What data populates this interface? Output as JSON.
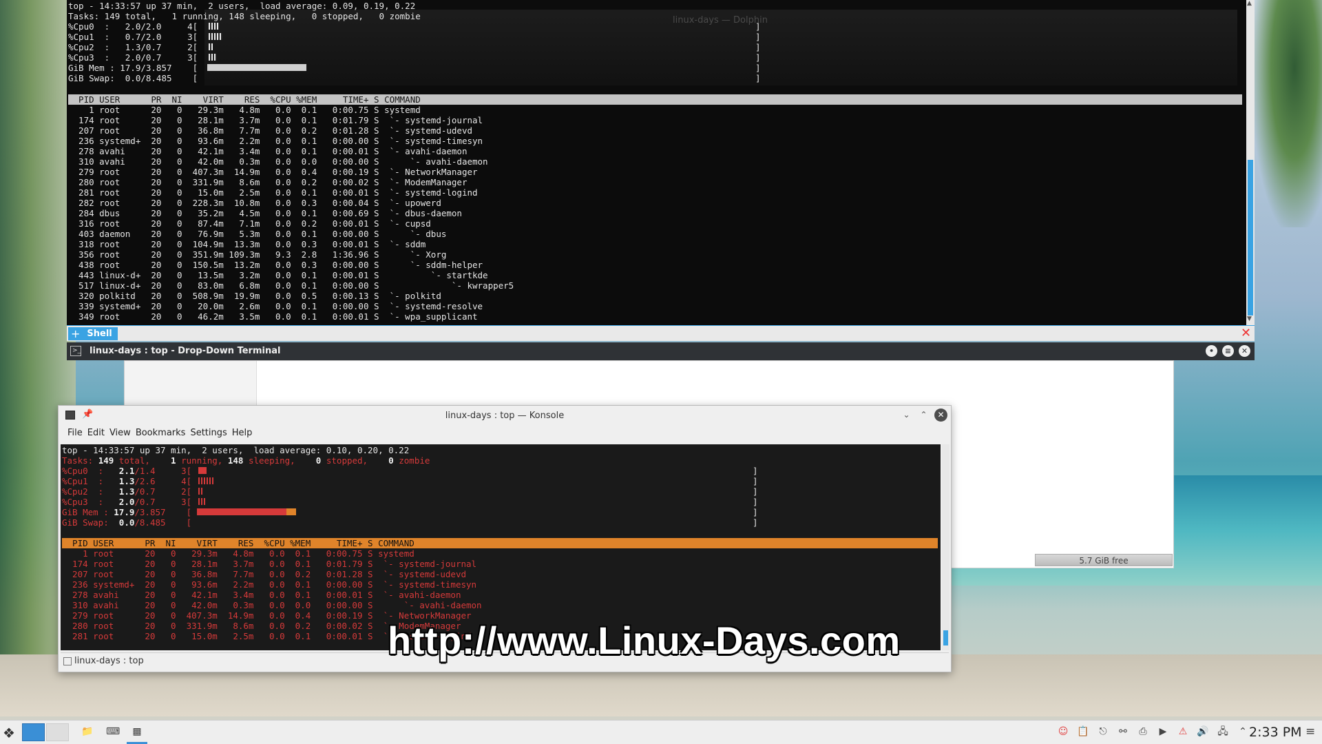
{
  "dropdown_terminal": {
    "ghost_title": "linux-days — Dolphin",
    "top_lines": [
      "top - 14:33:57 up 37 min,  2 users,  load average: 0.09, 0.19, 0.22",
      "Tasks: 149 total,   1 running, 148 sleeping,   0 stopped,   0 zombie",
      "%Cpu0  :   2.0/2.0     4[",
      "%Cpu1  :   0.7/2.0     3[",
      "%Cpu2  :   1.3/0.7     2[",
      "%Cpu3  :   2.0/0.7     3[",
      "GiB Mem : 17.9/3.857    [",
      "GiB Swap:  0.0/8.485    ["
    ],
    "header": "  PID USER      PR  NI    VIRT    RES  %CPU %MEM     TIME+ S COMMAND",
    "rows": [
      "    1 root      20   0   29.3m   4.8m   0.0  0.1   0:00.75 S systemd",
      "  174 root      20   0   28.1m   3.7m   0.0  0.1   0:01.79 S  `- systemd-journal",
      "  207 root      20   0   36.8m   7.7m   0.0  0.2   0:01.28 S  `- systemd-udevd",
      "  236 systemd+  20   0   93.6m   2.2m   0.0  0.1   0:00.00 S  `- systemd-timesyn",
      "  278 avahi     20   0   42.1m   3.4m   0.0  0.1   0:00.01 S  `- avahi-daemon",
      "  310 avahi     20   0   42.0m   0.3m   0.0  0.0   0:00.00 S      `- avahi-daemon",
      "  279 root      20   0  407.3m  14.9m   0.0  0.4   0:00.19 S  `- NetworkManager",
      "  280 root      20   0  331.9m   8.6m   0.0  0.2   0:00.02 S  `- ModemManager",
      "  281 root      20   0   15.0m   2.5m   0.0  0.1   0:00.01 S  `- systemd-logind",
      "  282 root      20   0  228.3m  10.8m   0.0  0.3   0:00.04 S  `- upowerd",
      "  284 dbus      20   0   35.2m   4.5m   0.0  0.1   0:00.69 S  `- dbus-daemon",
      "  316 root      20   0   87.4m   7.1m   0.0  0.2   0:00.01 S  `- cupsd",
      "  403 daemon    20   0   76.9m   5.3m   0.0  0.1   0:00.00 S      `- dbus",
      "  318 root      20   0  104.9m  13.3m   0.0  0.3   0:00.01 S  `- sddm",
      "  356 root      20   0  351.9m 109.3m   9.3  2.8   1:36.96 S      `- Xorg",
      "  438 root      20   0  150.5m  13.2m   0.0  0.3   0:00.00 S      `- sddm-helper",
      "  443 linux-d+  20   0   13.5m   3.2m   0.0  0.1   0:00.01 S          `- startkde",
      "  517 linux-d+  20   0   83.0m   6.8m   0.0  0.1   0:00.00 S              `- kwrapper5",
      "  320 polkitd   20   0  508.9m  19.9m   0.0  0.5   0:00.13 S  `- polkitd",
      "  339 systemd+  20   0   20.0m   2.6m   0.0  0.1   0:00.00 S  `- systemd-resolve",
      "  349 root      20   0   46.2m   3.5m   0.0  0.1   0:00.01 S  `- wpa_supplicant"
    ],
    "tab_label": "Shell",
    "title": "linux-days : top - Drop-Down Terminal"
  },
  "dolphin": {
    "free_space": "5.7 GiB free"
  },
  "konsole": {
    "title": "linux-days : top — Konsole",
    "menu": [
      "File",
      "Edit",
      "View",
      "Bookmarks",
      "Settings",
      "Help"
    ],
    "line1": "top - 14:33:57 up 37 min,  2 users,  load average: 0.10, 0.20, 0.22",
    "tasks": {
      "prefix": "Tasks: ",
      "total": "149",
      "total_label": " total,",
      "running": "    1",
      "running_label": " running,",
      "sleeping": " 148",
      "sleeping_label": " sleeping,",
      "stopped": "    0",
      "stopped_label": " stopped,",
      "zombie": "    0",
      "zombie_label": " zombie"
    },
    "cpu": [
      {
        "label": "%Cpu0  :  ",
        "val": " 2.1",
        "rest": "/1.4     3["
      },
      {
        "label": "%Cpu1  :  ",
        "val": " 1.3",
        "rest": "/2.6     4["
      },
      {
        "label": "%Cpu2  :  ",
        "val": " 1.3",
        "rest": "/0.7     2["
      },
      {
        "label": "%Cpu3  :  ",
        "val": " 2.0",
        "rest": "/0.7     3["
      }
    ],
    "mem": {
      "label": "GiB Mem : ",
      "val": "17.9",
      "rest": "/3.857    ["
    },
    "swap": {
      "label": "GiB Swap:  ",
      "val": "0.0",
      "rest": "/8.485    ["
    },
    "header": "  PID USER      PR  NI    VIRT    RES  %CPU %MEM     TIME+ S COMMAND",
    "rows": [
      "    1 root      20   0   29.3m   4.8m   0.0  0.1   0:00.75 S systemd",
      "  174 root      20   0   28.1m   3.7m   0.0  0.1   0:01.79 S  `- systemd-journal",
      "  207 root      20   0   36.8m   7.7m   0.0  0.2   0:01.28 S  `- systemd-udevd",
      "  236 systemd+  20   0   93.6m   2.2m   0.0  0.1   0:00.00 S  `- systemd-timesyn",
      "  278 avahi     20   0   42.1m   3.4m   0.0  0.1   0:00.01 S  `- avahi-daemon",
      "  310 avahi     20   0   42.0m   0.3m   0.0  0.0   0:00.00 S      `- avahi-daemon",
      "  279 root      20   0  407.3m  14.9m   0.0  0.4   0:00.19 S  `- NetworkManager",
      "  280 root      20   0  331.9m   8.6m   0.0  0.2   0:00.02 S  `- ModemManager",
      "  281 root      20   0   15.0m   2.5m   0.0  0.1   0:00.01 S  `- systemd-logind"
    ],
    "tab_label": "linux-days : top"
  },
  "watermark": "http://www.Linux-Days.com",
  "taskbar": {
    "clock": "2:33 PM"
  },
  "colors": {
    "accent": "#3aa3e3",
    "top_red": "#d63a3a",
    "top_header_orange": "#e0842a"
  }
}
